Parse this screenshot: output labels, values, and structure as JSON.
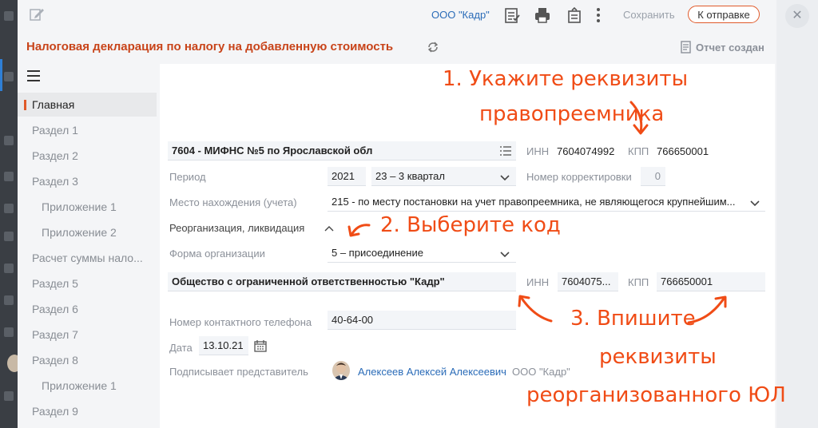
{
  "toolbar": {
    "org_name": "ООО \"Кадр\"",
    "save_label": "Сохранить",
    "send_label": "К отправке"
  },
  "header": {
    "title": "Налоговая декларация по налогу на добавленную стоимость",
    "report_status": "Отчет создан"
  },
  "sidebar": {
    "items": [
      {
        "label": "Главная"
      },
      {
        "label": "Раздел 1"
      },
      {
        "label": "Раздел 2"
      },
      {
        "label": "Раздел 3"
      },
      {
        "label": "Приложение 1"
      },
      {
        "label": "Приложение 2"
      },
      {
        "label": "Расчет суммы нало..."
      },
      {
        "label": "Раздел 5"
      },
      {
        "label": "Раздел 6"
      },
      {
        "label": "Раздел 7"
      },
      {
        "label": "Раздел 8"
      },
      {
        "label": "Приложение 1"
      },
      {
        "label": "Раздел 9"
      }
    ]
  },
  "form": {
    "tax_office": "7604 - МИФНС №5 по Ярославской обл",
    "inn_label": "ИНН",
    "inn": "7604074992",
    "kpp_label": "КПП",
    "kpp": "766650001",
    "period_label": "Период",
    "year": "2021",
    "quarter": "23 – 3 квартал",
    "correction_label": "Номер корректировки",
    "correction": "0",
    "location_label": "Место нахождения (учета)",
    "location": "215 - по месту постановки на учет правопреемника, не являющегося крупнейшим...",
    "reorg_label": "Реорганизация, ликвидация",
    "org_form_label": "Форма организации",
    "org_form": "5 – присоединение",
    "reorg_org_name": "Общество с ограниченной ответственностью \"Кадр\"",
    "reorg_inn_label": "ИНН",
    "reorg_inn": "7604075...",
    "reorg_kpp_label": "КПП",
    "reorg_kpp": "766650001",
    "phone_label": "Номер контактного телефона",
    "phone": "40-64-00",
    "date_label": "Дата",
    "date": "13.10.21",
    "signer_label": "Подписывает представитель",
    "signer_name": "Алексеев Алексей Алексеевич",
    "signer_org": "ООО \"Кадр\""
  },
  "annotations": {
    "step1_line1": "1. Укажите реквизиты",
    "step1_line2": "правопреемника",
    "step2": "2. Выберите код",
    "step3_line1": "3. Впишите",
    "step3_line2": "реквизиты",
    "step3_line3": "реорганизованного ЮЛ"
  },
  "colors": {
    "accent": "#e05a2a",
    "link": "#2b6cb8",
    "annotation": "#f04c16"
  }
}
